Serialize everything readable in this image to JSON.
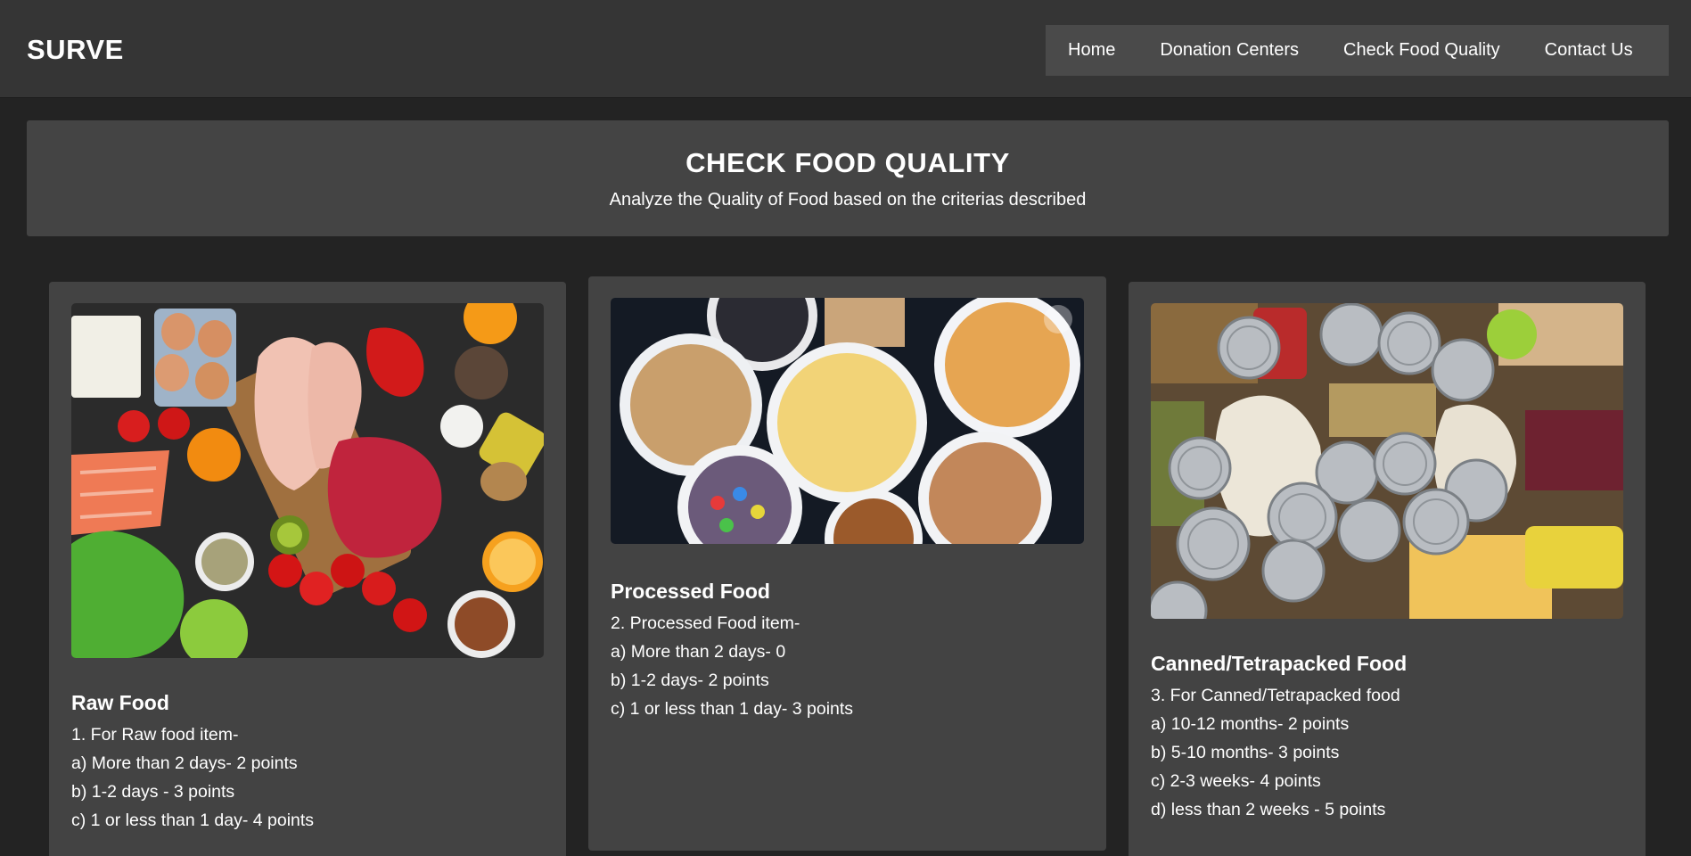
{
  "brand": "SURVE",
  "nav": {
    "items": [
      "Home",
      "Donation Centers",
      "Check Food Quality",
      "Contact Us"
    ]
  },
  "hero": {
    "title": "CHECK FOOD QUALITY",
    "subtitle": "Analyze the Quality of Food based on the criterias described"
  },
  "cards": [
    {
      "title": "Raw Food",
      "lines": [
        "1. For Raw food item-",
        "a) More than 2 days- 2 points",
        "b) 1-2 days - 3 points",
        "c) 1 or less than 1 day- 4 points"
      ]
    },
    {
      "title": "Processed Food",
      "lines": [
        "2. Processed Food item-",
        "a) More than 2 days- 0",
        "b) 1-2 days- 2 points",
        "c) 1 or less than 1 day- 3 points"
      ]
    },
    {
      "title": "Canned/Tetrapacked Food",
      "lines": [
        "3. For Canned/Tetrapacked food",
        "a) 10-12 months- 2 points",
        "b) 5-10 months- 3 points",
        "c) 2-3 weeks- 4 points",
        "d) less than 2 weeks - 5 points"
      ]
    }
  ],
  "colors": {
    "page_bg": "#232323",
    "header_bg": "#353535",
    "nav_bg": "#4a4a4a",
    "panel_bg": "#444444",
    "card_bg": "#434343",
    "text": "#ffffff"
  }
}
